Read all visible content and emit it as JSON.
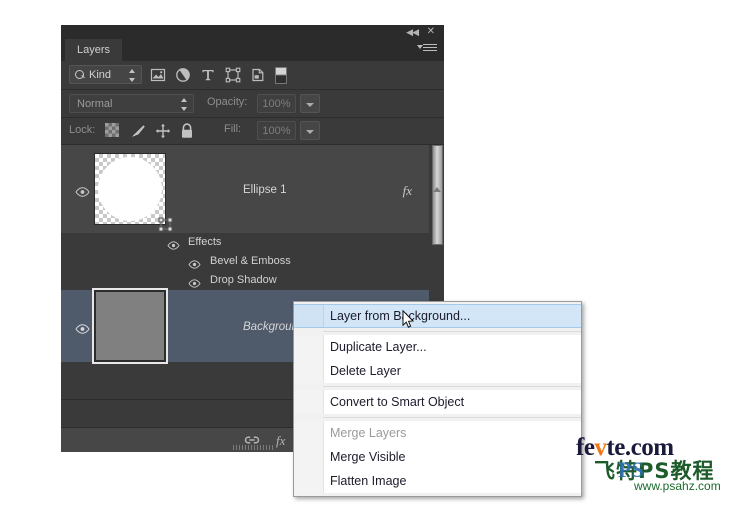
{
  "panel": {
    "tab_label": "Layers",
    "collapse_icon": "double-chevron-left-icon",
    "close_icon": "close-icon",
    "menu_icon": "panel-menu-icon"
  },
  "filter_bar": {
    "kind_label": "Kind",
    "search_icon": "search-icon",
    "icons": [
      {
        "name": "filter-pixel-icon",
        "title": "Filter for pixel layers"
      },
      {
        "name": "filter-adjustment-icon",
        "title": "Filter for adjustment layers"
      },
      {
        "name": "filter-type-icon",
        "title": "Filter for type layers"
      },
      {
        "name": "filter-shape-icon",
        "title": "Filter for shape layers"
      },
      {
        "name": "filter-smart-object-icon",
        "title": "Filter for smart objects"
      },
      {
        "name": "filter-toggle-icon",
        "title": "Turn layer filtering on/off"
      }
    ]
  },
  "blend_bar": {
    "blend_mode": "Normal",
    "opacity_label": "Opacity:",
    "opacity_value": "100%"
  },
  "lock_bar": {
    "lock_label": "Lock:",
    "fill_label": "Fill:",
    "fill_value": "100%",
    "lock_icons": [
      {
        "name": "lock-transparent-pixels-icon"
      },
      {
        "name": "lock-image-pixels-icon"
      },
      {
        "name": "lock-position-icon"
      },
      {
        "name": "lock-all-icon"
      }
    ]
  },
  "layers": [
    {
      "name": "Ellipse 1",
      "italic": false,
      "visible": true,
      "has_fx": true,
      "fx_label": "fx",
      "thumb": "white-ellipse-on-transparent",
      "vector_mask_badge": true,
      "effects": {
        "root_label": "Effects",
        "items": [
          "Bevel & Emboss",
          "Drop Shadow"
        ]
      }
    },
    {
      "name": "Background",
      "italic": true,
      "visible": true,
      "has_fx": false,
      "selected": true,
      "thumb": "gray-fill"
    }
  ],
  "footer": {
    "icons": [
      {
        "name": "link-layers-icon",
        "label": "link"
      },
      {
        "name": "layer-style-fx-icon",
        "label": "fx"
      }
    ],
    "grip": "resize-grip"
  },
  "context_menu": {
    "items": [
      {
        "label": "Layer from Background...",
        "state": "highlight"
      },
      {
        "sep": true
      },
      {
        "label": "Duplicate Layer...",
        "state": "normal"
      },
      {
        "label": "Delete Layer",
        "state": "normal"
      },
      {
        "sep": true
      },
      {
        "label": "Convert to Smart Object",
        "state": "normal"
      },
      {
        "sep": true
      },
      {
        "label": "Merge Layers",
        "state": "disabled"
      },
      {
        "label": "Merge Visible",
        "state": "normal"
      },
      {
        "label": "Flatten Image",
        "state": "normal"
      }
    ]
  },
  "cursor": {
    "name": "arrow-cursor"
  },
  "watermark": {
    "site_pre": "fe",
    "site_v": "v",
    "site_post": "te.com",
    "cn_text": "飞特PS教程",
    "ps_overlay": "PS",
    "url": "www.psahz.com"
  }
}
